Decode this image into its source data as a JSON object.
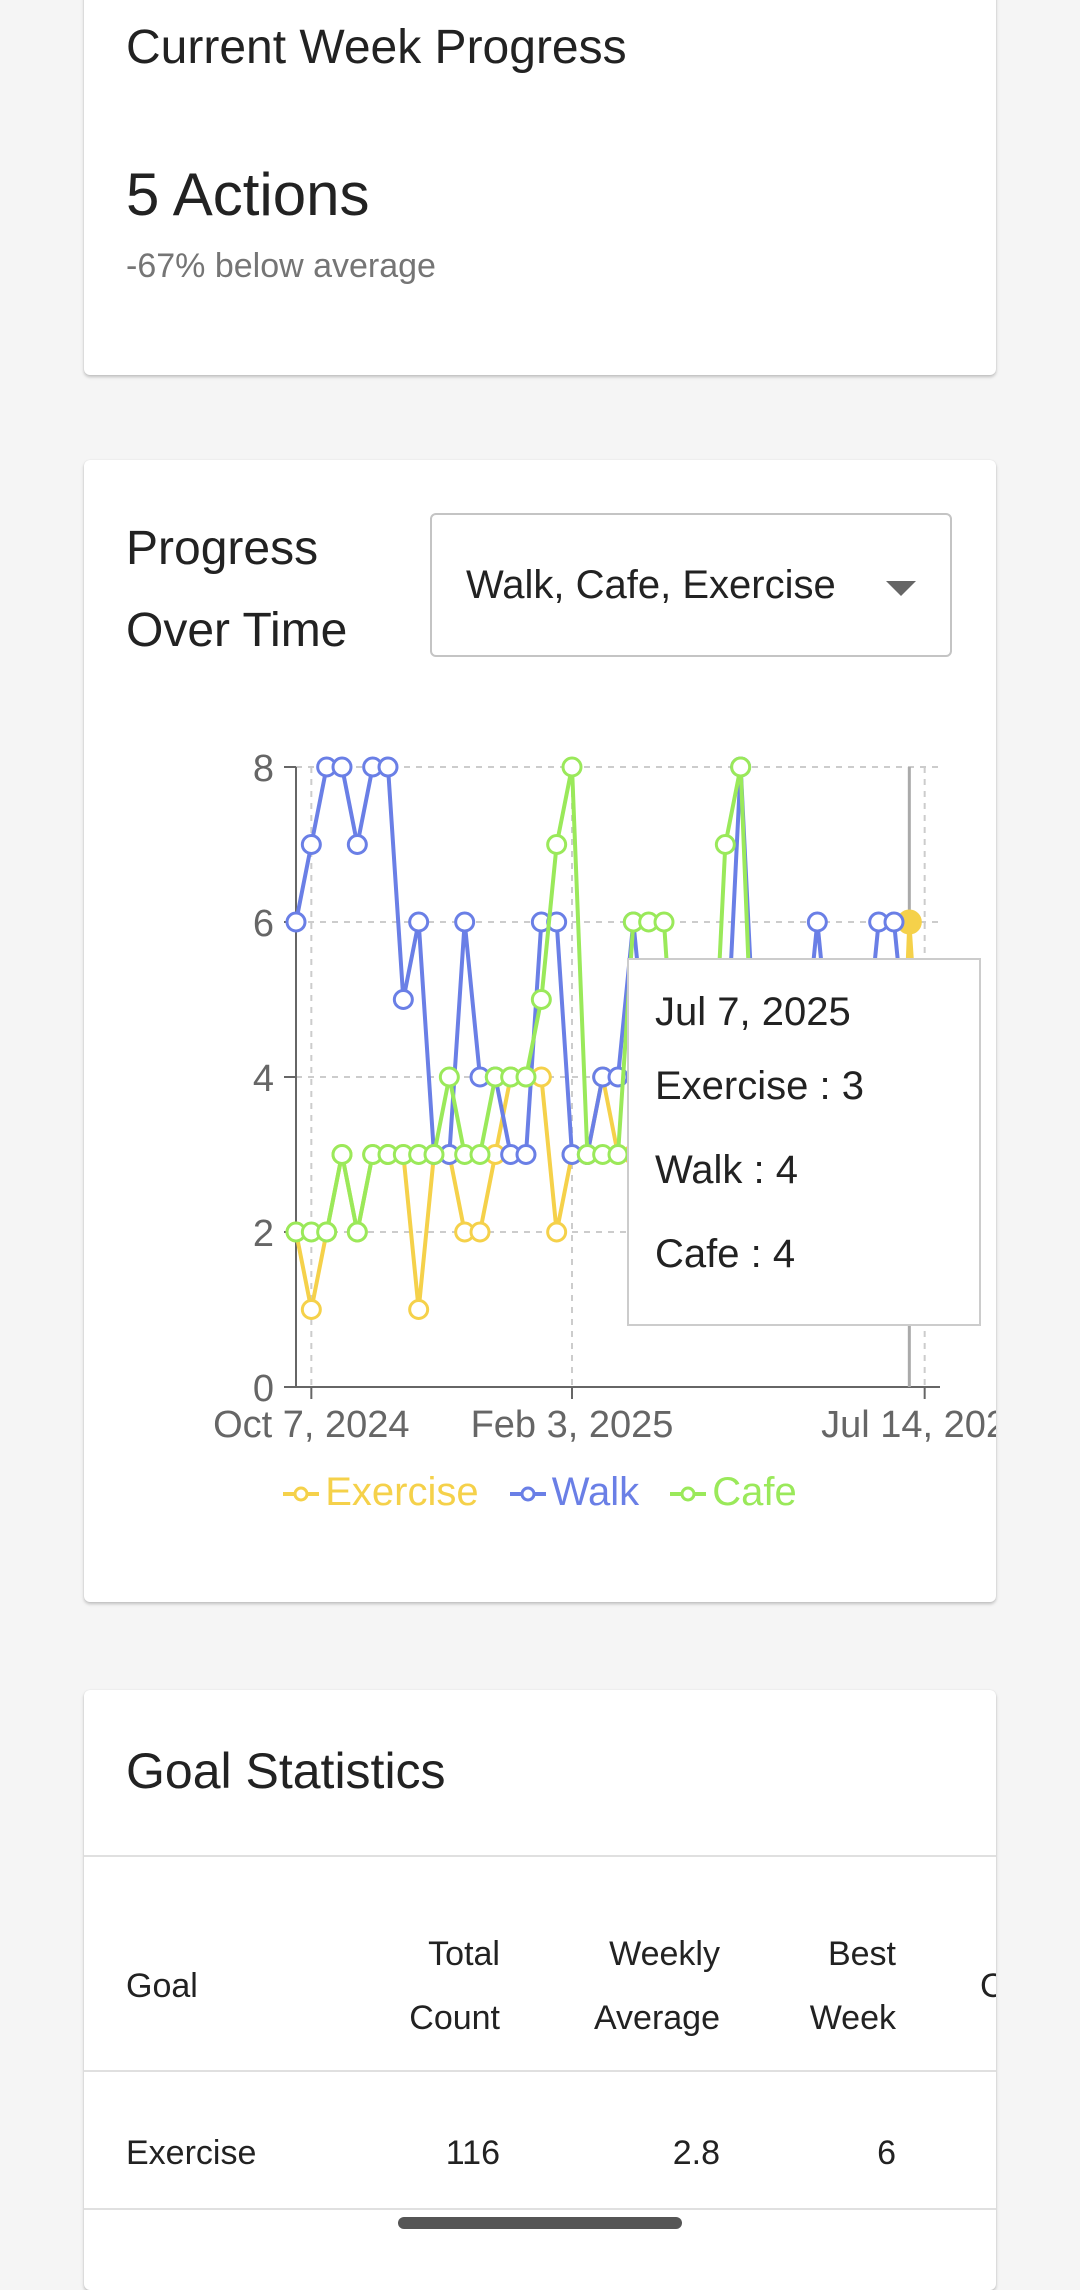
{
  "week_card": {
    "title": "Current Week Progress",
    "value": "5 Actions",
    "subtext": "-67% below average"
  },
  "progress_card": {
    "title": "Progress Over Time",
    "select_value": "Walk, Cafe, Exercise",
    "tooltip": {
      "date": "Jul 7, 2025",
      "rows": [
        {
          "label": "Exercise : 3",
          "color": "#f5d14a"
        },
        {
          "label": "Walk : 4",
          "color": "#6a7fe6"
        },
        {
          "label": "Cafe : 4",
          "color": "#9ae95a"
        }
      ]
    }
  },
  "chart_data": {
    "type": "line",
    "ylim": [
      0,
      8
    ],
    "yticks": [
      "0",
      "2",
      "4",
      "6",
      "8"
    ],
    "xtick_labels": [
      "Oct 7, 2024",
      "Feb 3, 2025",
      "Jul 14, 2025"
    ],
    "grid": true,
    "legend_position": "bottom",
    "series": [
      {
        "name": "Exercise",
        "color": "#f5d14a",
        "values": [
          2,
          1,
          2,
          3,
          2,
          3,
          3,
          3,
          1,
          3,
          3,
          2,
          2,
          3,
          4,
          4,
          4,
          2,
          3,
          3,
          4,
          3,
          3,
          3,
          3,
          3,
          3,
          3,
          3,
          3,
          3,
          3,
          3,
          3,
          3,
          3,
          3,
          3,
          3,
          1,
          6,
          3,
          1
        ]
      },
      {
        "name": "Walk",
        "color": "#6a7fe6",
        "values": [
          6,
          7,
          8,
          8,
          7,
          8,
          8,
          5,
          6,
          3,
          3,
          6,
          4,
          4,
          3,
          3,
          6,
          6,
          3,
          3,
          4,
          4,
          6,
          4,
          4,
          4,
          4,
          4,
          4,
          8,
          4,
          4,
          4,
          4,
          6,
          4,
          4,
          4,
          6,
          6,
          4,
          4,
          4
        ]
      },
      {
        "name": "Cafe",
        "color": "#9ae95a",
        "values": [
          2,
          2,
          2,
          3,
          2,
          3,
          3,
          3,
          3,
          3,
          4,
          3,
          3,
          4,
          4,
          4,
          5,
          7,
          8,
          3,
          3,
          3,
          6,
          6,
          6,
          3,
          3,
          3,
          7,
          8,
          3,
          3,
          3,
          3,
          3,
          3,
          3,
          3,
          3,
          1,
          3,
          4,
          4
        ]
      }
    ],
    "highlight_index": 40
  },
  "stats_card": {
    "title": "Goal Statistics",
    "headers": [
      "Goal",
      "Total\nCount",
      "Weekly\nAverage",
      "Best\nWeek",
      "C"
    ],
    "rows": [
      {
        "goal": "Exercise",
        "total": "116",
        "avg": "2.8",
        "best": "6"
      }
    ]
  }
}
